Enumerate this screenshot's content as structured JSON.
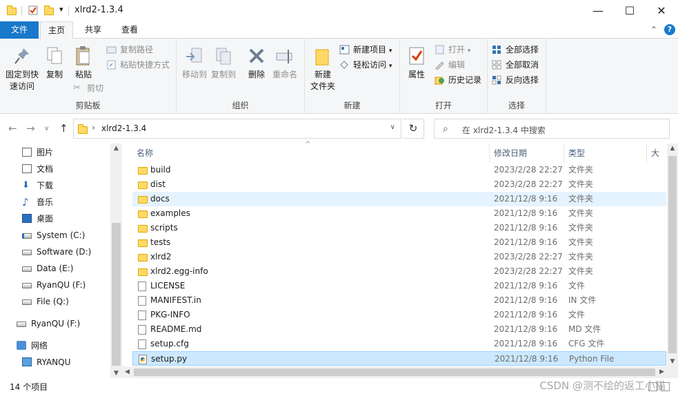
{
  "window": {
    "title": "xlrd2-1.3.4",
    "qa_dropdown": "▾",
    "minimize": "—",
    "maximize": "☐",
    "close": "✕"
  },
  "ribbon_tabs": {
    "file": "文件",
    "home": "主页",
    "share": "共享",
    "view": "查看",
    "collapse": "⌃",
    "help": "?"
  },
  "ribbon": {
    "clipboard": {
      "label": "剪贴板",
      "pin_line1": "固定到快",
      "pin_line2": "速访问",
      "copy": "复制",
      "paste": "粘贴",
      "copy_path": "复制路径",
      "paste_shortcut": "粘贴快捷方式",
      "cut": "剪切"
    },
    "organize": {
      "label": "组织",
      "move_to": "移动到",
      "copy_to": "复制到",
      "delete": "删除",
      "rename": "重命名"
    },
    "new": {
      "label": "新建",
      "new_folder_line1": "新建",
      "new_folder_line2": "文件夹",
      "new_item": "新建项目",
      "easy_access": "轻松访问"
    },
    "open": {
      "label": "打开",
      "properties": "属性",
      "open": "打开",
      "edit": "编辑",
      "history": "历史记录"
    },
    "select": {
      "label": "选择",
      "select_all": "全部选择",
      "select_none": "全部取消",
      "invert": "反向选择"
    }
  },
  "nav": {
    "back": "←",
    "forward": "→",
    "recent": "∨",
    "up": "↑",
    "path_sep": "›",
    "path": "xlrd2-1.3.4",
    "dropdown": "∨",
    "refresh": "↻",
    "search_icon": "⌕",
    "search_placeholder": "在 xlrd2-1.3.4 中搜索"
  },
  "sidebar": {
    "items": [
      {
        "label": "图片",
        "icon": "pictures-icon"
      },
      {
        "label": "文档",
        "icon": "documents-icon"
      },
      {
        "label": "下载",
        "icon": "downloads-icon"
      },
      {
        "label": "音乐",
        "icon": "music-icon"
      },
      {
        "label": "桌面",
        "icon": "desktop-icon"
      },
      {
        "label": "System (C:)",
        "icon": "system-drive-icon"
      },
      {
        "label": "Software (D:)",
        "icon": "drive-icon"
      },
      {
        "label": "Data (E:)",
        "icon": "drive-icon"
      },
      {
        "label": "RyanQU (F:)",
        "icon": "drive-icon"
      },
      {
        "label": "File (Q:)",
        "icon": "drive-icon"
      },
      {
        "label": "RyanQU (F:)",
        "icon": "drive-icon"
      },
      {
        "label": "网络",
        "icon": "network-icon"
      },
      {
        "label": "RYANQU",
        "icon": "computer-icon"
      }
    ]
  },
  "columns": {
    "sort_indicator": "^",
    "name": "名称",
    "date": "修改日期",
    "type": "类型",
    "size": "大小"
  },
  "files": [
    {
      "name": "build",
      "date": "2023/2/28 22:27",
      "type": "文件夹",
      "kind": "folder"
    },
    {
      "name": "dist",
      "date": "2023/2/28 22:27",
      "type": "文件夹",
      "kind": "folder"
    },
    {
      "name": "docs",
      "date": "2021/12/8 9:16",
      "type": "文件夹",
      "kind": "folder"
    },
    {
      "name": "examples",
      "date": "2021/12/8 9:16",
      "type": "文件夹",
      "kind": "folder"
    },
    {
      "name": "scripts",
      "date": "2021/12/8 9:16",
      "type": "文件夹",
      "kind": "folder"
    },
    {
      "name": "tests",
      "date": "2021/12/8 9:16",
      "type": "文件夹",
      "kind": "folder"
    },
    {
      "name": "xlrd2",
      "date": "2023/2/28 22:27",
      "type": "文件夹",
      "kind": "folder"
    },
    {
      "name": "xlrd2.egg-info",
      "date": "2023/2/28 22:27",
      "type": "文件夹",
      "kind": "folder"
    },
    {
      "name": "LICENSE",
      "date": "2021/12/8 9:16",
      "type": "文件",
      "kind": "doc"
    },
    {
      "name": "MANIFEST.in",
      "date": "2021/12/8 9:16",
      "type": "IN 文件",
      "kind": "doc"
    },
    {
      "name": "PKG-INFO",
      "date": "2021/12/8 9:16",
      "type": "文件",
      "kind": "doc"
    },
    {
      "name": "README.md",
      "date": "2021/12/8 9:16",
      "type": "MD 文件",
      "kind": "doc"
    },
    {
      "name": "setup.cfg",
      "date": "2021/12/8 9:16",
      "type": "CFG 文件",
      "kind": "doc"
    },
    {
      "name": "setup.py",
      "date": "2021/12/8 9:16",
      "type": "Python File",
      "kind": "py"
    }
  ],
  "hover_row": "docs",
  "selected_row": "setup.py",
  "status": {
    "count": "14 个项目",
    "watermark": "CSDN @测不绘的返工小猫"
  },
  "colors": {
    "accent": "#1979ca",
    "selection": "#cce8ff",
    "hover": "#e5f3ff"
  }
}
